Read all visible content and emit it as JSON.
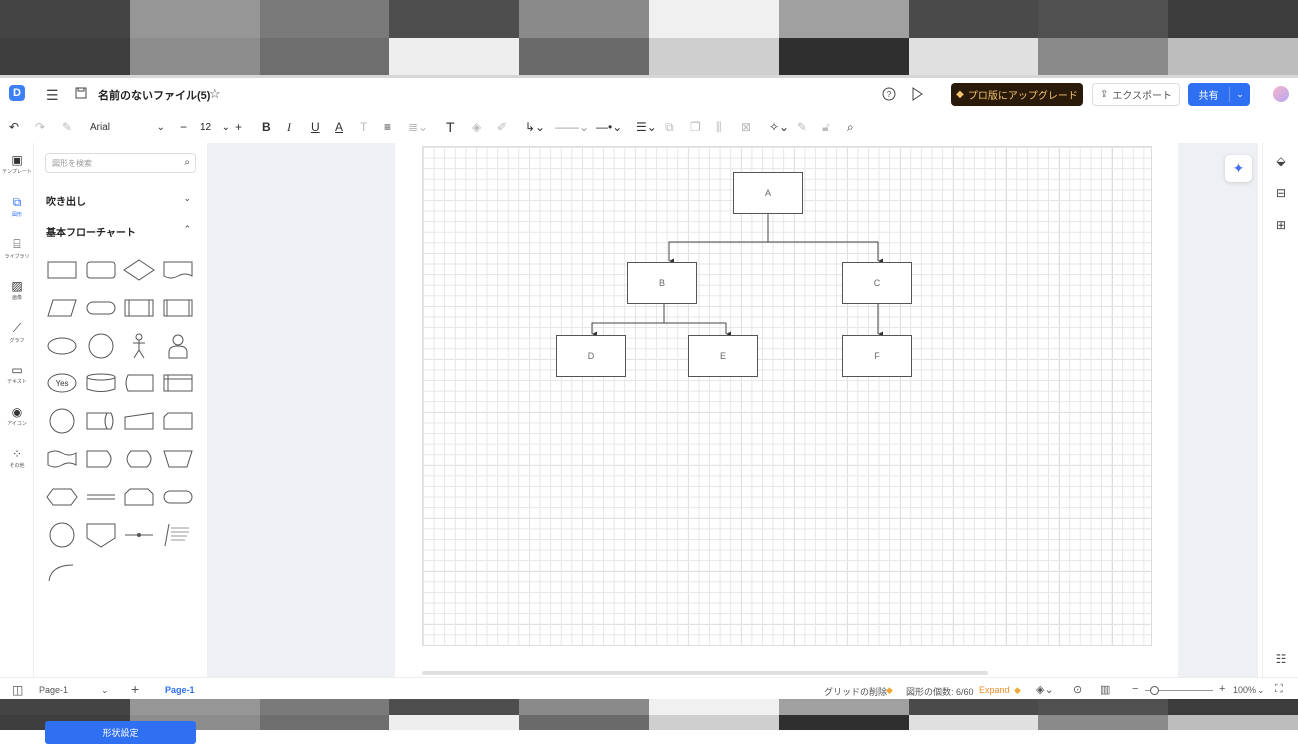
{
  "checker": {
    "top": [
      "#444444",
      "#969696",
      "#7a7a7a",
      "#4e4e4e",
      "#8a8a8a",
      "#f0f0f0",
      "#a0a0a0",
      "#4a4a4a",
      "#505050",
      "#3c3c3c",
      "#3e3e3e",
      "#8c8c8c",
      "#6e6e6e",
      "#eeeeee",
      "#6a6a6a",
      "#cfcfcf",
      "#2f2f2f",
      "#e0e0e0",
      "#8a8a8a",
      "#bdbdbd"
    ],
    "bottom": [
      "#444444",
      "#969696",
      "#7a7a7a",
      "#4e4e4e",
      "#8a8a8a",
      "#f0f0f0",
      "#a0a0a0",
      "#4a4a4a",
      "#505050",
      "#3c3c3c",
      "#3e3e3e",
      "#8c8c8c",
      "#6e6e6e",
      "#eeeeee",
      "#6a6a6a",
      "#cfcfcf",
      "#2f2f2f",
      "#e0e0e0",
      "#8a8a8a",
      "#bdbdbd"
    ]
  },
  "header": {
    "file_title": "名前のないファイル(5)",
    "upgrade_label": "プロ版にアップグレード",
    "export_label": "エクスポート",
    "share_label": "共有"
  },
  "toolbar": {
    "font_name": "Arial",
    "font_size": "12"
  },
  "left_rail": [
    {
      "icon": "template-icon",
      "label": "テンプレート"
    },
    {
      "icon": "shapes-icon",
      "label": "図形"
    },
    {
      "icon": "library-icon",
      "label": "ライブラリ"
    },
    {
      "icon": "image-icon",
      "label": "画像"
    },
    {
      "icon": "chart-icon",
      "label": "グラフ"
    },
    {
      "icon": "text-icon",
      "label": "テキスト"
    },
    {
      "icon": "icon-icon",
      "label": "アイコン"
    },
    {
      "icon": "more-icon",
      "label": "その他"
    }
  ],
  "shape_panel": {
    "search_placeholder": "図形を検索",
    "section_callout": "吹き出し",
    "section_flowchart": "基本フローチャート",
    "yes_label": "Yes",
    "apply_button": "形状設定"
  },
  "diagram": {
    "nodes": [
      "A",
      "B",
      "C",
      "D",
      "E",
      "F"
    ]
  },
  "status": {
    "page_selector": "Page-1",
    "page_tab": "Page-1",
    "grid_remove": "グリッドの削除",
    "shape_count": "図形の個数: 6/60",
    "expand": "Expand",
    "zoom": "100%"
  }
}
